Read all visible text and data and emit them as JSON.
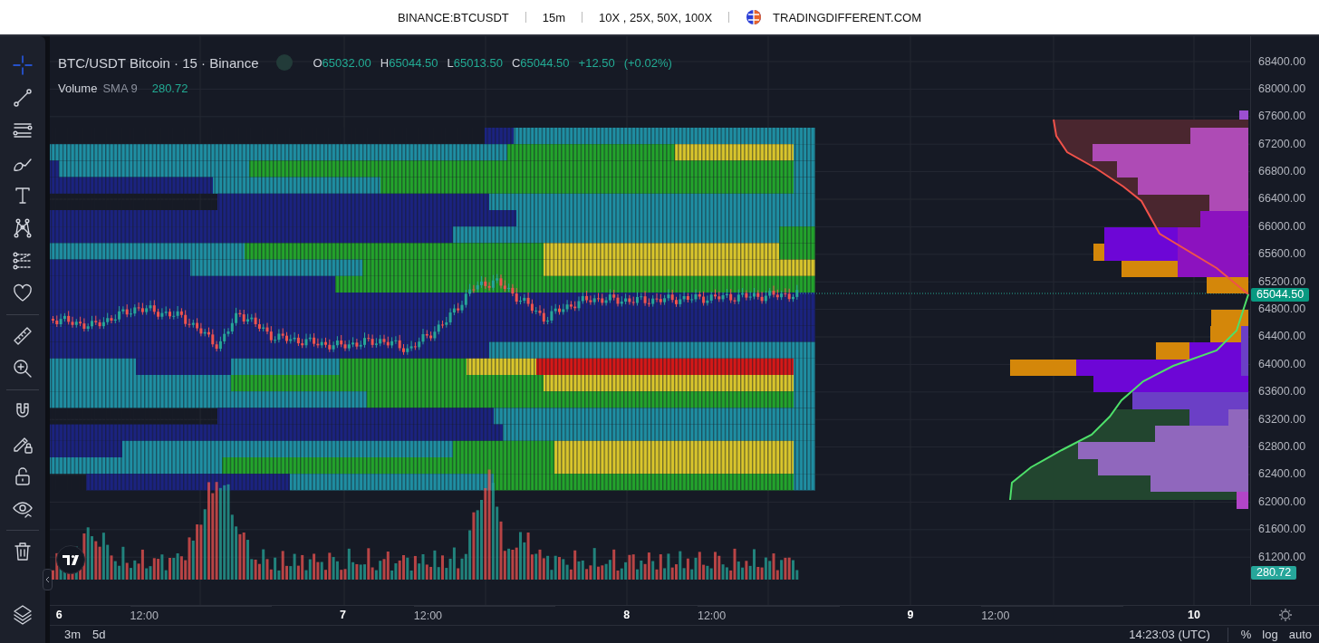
{
  "header": {
    "items": [
      "BINANCE:BTCUSDT",
      "15m",
      "10X , 25X, 50X, 100X"
    ],
    "site": "TRADINGDIFFERENT.COM"
  },
  "toolbar": {
    "groups": [
      [
        {
          "kind": "crosshair",
          "selected": true
        },
        {
          "kind": "trendline",
          "selected": false
        },
        {
          "kind": "hlines",
          "selected": false
        },
        {
          "kind": "brush",
          "selected": false
        },
        {
          "kind": "text",
          "selected": false
        },
        {
          "kind": "pattern",
          "selected": false
        },
        {
          "kind": "forecast",
          "selected": false
        },
        {
          "kind": "heart",
          "selected": false
        }
      ],
      [
        {
          "kind": "ruler",
          "selected": false
        },
        {
          "kind": "zoom",
          "selected": false
        }
      ],
      [
        {
          "kind": "magnet",
          "selected": false
        },
        {
          "kind": "pencillock",
          "selected": false
        },
        {
          "kind": "lock",
          "selected": false
        },
        {
          "kind": "eye",
          "selected": false
        }
      ],
      [
        {
          "kind": "trash",
          "selected": false
        }
      ]
    ],
    "bottom": {
      "kind": "layers",
      "selected": false
    }
  },
  "legend": {
    "symbol": "BTC/USDT Bitcoin · 15  · Binance",
    "ohlc": [
      {
        "label": "O",
        "value": "65032.00"
      },
      {
        "label": "H",
        "value": "65044.50"
      },
      {
        "label": "L",
        "value": "65013.50"
      },
      {
        "label": "C",
        "value": "65044.50"
      }
    ],
    "change": "+12.50",
    "change_pct": "(+0.02%)",
    "volume": {
      "name": "Volume",
      "study": "SMA 9",
      "value": "280.72"
    }
  },
  "price_axis": {
    "labels": [
      "68400.00",
      "68000.00",
      "67600.00",
      "67200.00",
      "66800.00",
      "66400.00",
      "66000.00",
      "65600.00",
      "65200.00",
      "64800.00",
      "64400.00",
      "64000.00",
      "63600.00",
      "63200.00",
      "62800.00",
      "62400.00",
      "62000.00",
      "61600.00",
      "61200.00"
    ],
    "last_price": "65044.50",
    "volume_tag": "280.72"
  },
  "time_axis": [
    {
      "label": "6",
      "kind": "day"
    },
    {
      "label": "12:00",
      "kind": "time"
    },
    {
      "label": "7",
      "kind": "day"
    },
    {
      "label": "12:00",
      "kind": "time"
    },
    {
      "label": "8",
      "kind": "day"
    },
    {
      "label": "12:00",
      "kind": "time"
    },
    {
      "label": "9",
      "kind": "day"
    },
    {
      "label": "12:00",
      "kind": "time"
    },
    {
      "label": "10",
      "kind": "day"
    }
  ],
  "bottom_bar": {
    "ranges": [
      "3m",
      "5d"
    ],
    "clock": "14:23:03 (UTC)",
    "options": [
      "%",
      "log",
      "auto"
    ]
  }
}
